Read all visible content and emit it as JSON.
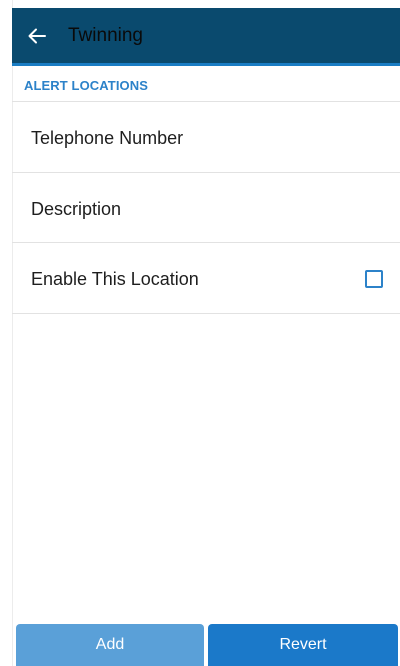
{
  "header": {
    "title": "Twinning",
    "back_icon": "arrow-left-icon"
  },
  "colors": {
    "app_bar": "#0a4a6e",
    "accent": "#2c82c9",
    "add_button": "#5aa0d8",
    "revert_button": "#1b79c9"
  },
  "section": {
    "header": "ALERT LOCATIONS"
  },
  "fields": [
    {
      "label": "Telephone Number"
    },
    {
      "label": "Description"
    },
    {
      "label": "Enable This Location",
      "checked": false
    }
  ],
  "actions": {
    "add_label": "Add",
    "revert_label": "Revert"
  }
}
